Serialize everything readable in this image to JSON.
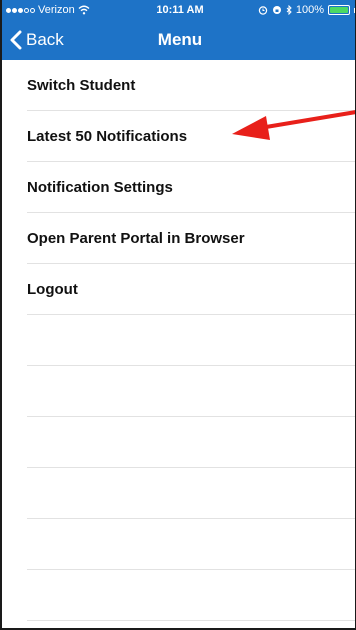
{
  "status": {
    "carrier": "Verizon",
    "time": "10:11 AM",
    "battery": "100%",
    "battery_level": 1.0,
    "icons": [
      "wifi-icon",
      "alarm-icon",
      "lock-rotation-icon",
      "bluetooth-icon",
      "battery-icon"
    ]
  },
  "nav": {
    "back_label": "Back",
    "title": "Menu"
  },
  "menu": {
    "items": [
      {
        "label": "Switch Student"
      },
      {
        "label": "Latest 50 Notifications"
      },
      {
        "label": "Notification Settings"
      },
      {
        "label": "Open Parent Portal in Browser"
      },
      {
        "label": "Logout"
      }
    ]
  },
  "colors": {
    "header": "#1e73c7",
    "annotation_arrow": "#e8201a",
    "battery": "#4cd964"
  }
}
